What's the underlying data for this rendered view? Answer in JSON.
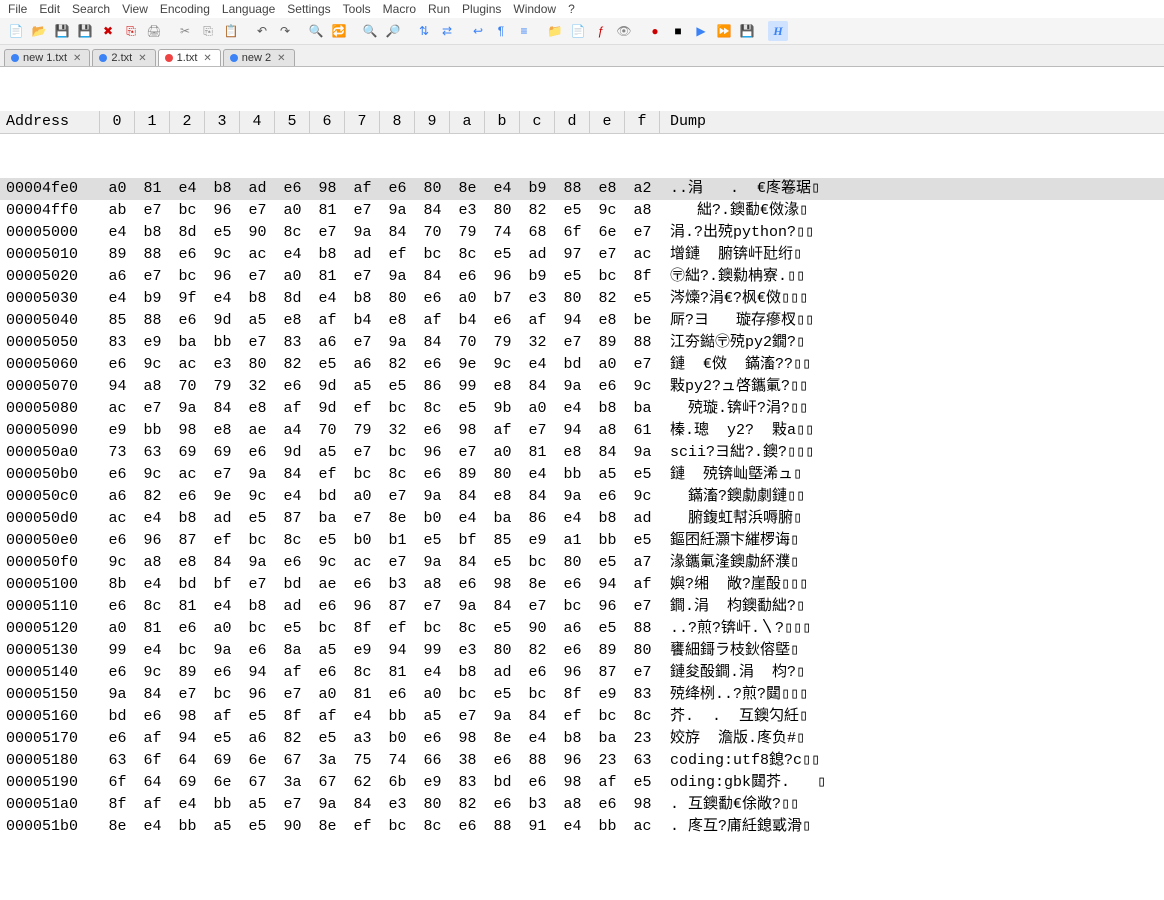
{
  "menu": [
    "File",
    "Edit",
    "Search",
    "View",
    "Encoding",
    "Language",
    "Settings",
    "Tools",
    "Macro",
    "Run",
    "Plugins",
    "Window",
    "?"
  ],
  "tabs": [
    {
      "label": "new 1.txt",
      "color": "#3b82f6",
      "active": false
    },
    {
      "label": "2.txt",
      "color": "#3b82f6",
      "active": false
    },
    {
      "label": "1.txt",
      "color": "#ef4444",
      "active": true
    },
    {
      "label": "new 2",
      "color": "#3b82f6",
      "active": false
    }
  ],
  "toolbar_icons": [
    {
      "name": "new-file-icon",
      "glyph": "📄",
      "col": "#6aa84f"
    },
    {
      "name": "open-icon",
      "glyph": "📂",
      "col": "#e2b007"
    },
    {
      "name": "save-icon",
      "glyph": "💾",
      "col": "#4a86e8"
    },
    {
      "name": "save-all-icon",
      "glyph": "💾",
      "col": "#4a86e8"
    },
    {
      "name": "close-icon",
      "glyph": "✖",
      "col": "#c00"
    },
    {
      "name": "close-all-icon",
      "glyph": "⎘",
      "col": "#c00"
    },
    {
      "name": "print-icon",
      "glyph": "🖨",
      "col": "#888"
    },
    {
      "name": "sep"
    },
    {
      "name": "cut-icon",
      "glyph": "✂",
      "col": "#888"
    },
    {
      "name": "copy-icon",
      "glyph": "⎘",
      "col": "#888"
    },
    {
      "name": "paste-icon",
      "glyph": "📋",
      "col": "#888"
    },
    {
      "name": "sep"
    },
    {
      "name": "undo-icon",
      "glyph": "↶",
      "col": "#555"
    },
    {
      "name": "redo-icon",
      "glyph": "↷",
      "col": "#555"
    },
    {
      "name": "sep"
    },
    {
      "name": "find-icon",
      "glyph": "🔍",
      "col": "#555"
    },
    {
      "name": "replace-icon",
      "glyph": "🔁",
      "col": "#555"
    },
    {
      "name": "sep"
    },
    {
      "name": "zoom-in-icon",
      "glyph": "🔍",
      "col": "#3b82f6"
    },
    {
      "name": "zoom-out-icon",
      "glyph": "🔎",
      "col": "#3b82f6"
    },
    {
      "name": "sep"
    },
    {
      "name": "sync-v-icon",
      "glyph": "⇅",
      "col": "#3b82f6"
    },
    {
      "name": "sync-h-icon",
      "glyph": "⇄",
      "col": "#3b82f6"
    },
    {
      "name": "sep"
    },
    {
      "name": "wordwrap-icon",
      "glyph": "↩",
      "col": "#3b82f6"
    },
    {
      "name": "show-all-icon",
      "glyph": "¶",
      "col": "#3b82f6"
    },
    {
      "name": "indent-icon",
      "glyph": "≡",
      "col": "#3b82f6"
    },
    {
      "name": "sep"
    },
    {
      "name": "folder-icon",
      "glyph": "📁",
      "col": "#e2b007"
    },
    {
      "name": "doc-icon",
      "glyph": "📄",
      "col": "#e2b007"
    },
    {
      "name": "func-icon",
      "glyph": "ƒ",
      "col": "#c00"
    },
    {
      "name": "eye-icon",
      "glyph": "👁",
      "col": "#888"
    },
    {
      "name": "sep"
    },
    {
      "name": "record-icon",
      "glyph": "●",
      "col": "#c00"
    },
    {
      "name": "stop-icon",
      "glyph": "■",
      "col": "#000"
    },
    {
      "name": "play-icon",
      "glyph": "▶",
      "col": "#3b82f6"
    },
    {
      "name": "fast-icon",
      "glyph": "⏩",
      "col": "#3b82f6"
    },
    {
      "name": "save-macro-icon",
      "glyph": "💾",
      "col": "#4a86e8"
    },
    {
      "name": "sep"
    },
    {
      "name": "hex-icon",
      "glyph": "H",
      "col": "#3b82f6"
    }
  ],
  "hex_header": {
    "address": "Address",
    "cols": [
      "0",
      "1",
      "2",
      "3",
      "4",
      "5",
      "6",
      "7",
      "8",
      "9",
      "a",
      "b",
      "c",
      "d",
      "e",
      "f"
    ],
    "dump": "Dump"
  },
  "hex_rows": [
    {
      "a": "00004fe0",
      "b": [
        "a0",
        "81",
        "e4",
        "b8",
        "ad",
        "e6",
        "98",
        "af",
        "e6",
        "80",
        "8e",
        "e4",
        "b9",
        "88",
        "e8",
        "a2"
      ],
      "d": "..涓   .  €庝箞琚▯"
    },
    {
      "a": "00004ff0",
      "b": [
        "ab",
        "e7",
        "bc",
        "96",
        "e7",
        "a0",
        "81",
        "e7",
        "9a",
        "84",
        "e3",
        "80",
        "82",
        "e5",
        "9c",
        "a8"
      ],
      "d": "   絀?.鐭勫€傚湪▯"
    },
    {
      "a": "00005000",
      "b": [
        "e4",
        "b8",
        "8d",
        "e5",
        "90",
        "8c",
        "e7",
        "9a",
        "84",
        "70",
        "79",
        "74",
        "68",
        "6f",
        "6e",
        "e7"
      ],
      "d": "涓.?出殑python?▯▯"
    },
    {
      "a": "00005010",
      "b": [
        "89",
        "88",
        "e6",
        "9c",
        "ac",
        "e4",
        "b8",
        "ad",
        "ef",
        "bc",
        "8c",
        "e5",
        "ad",
        "97",
        "e7",
        "ac"
      ],
      "d": "增鏈  腑锛屽瓧绗▯"
    },
    {
      "a": "00005020",
      "b": [
        "a6",
        "e7",
        "bc",
        "96",
        "e7",
        "a0",
        "81",
        "e7",
        "9a",
        "84",
        "e6",
        "96",
        "b9",
        "e5",
        "bc",
        "8f"
      ],
      "d": "〶絀?.鐭勬柟寮.▯▯"
    },
    {
      "a": "00005030",
      "b": [
        "e4",
        "b9",
        "9f",
        "e4",
        "b8",
        "8d",
        "e4",
        "b8",
        "80",
        "e6",
        "a0",
        "b7",
        "e3",
        "80",
        "82",
        "e5"
      ],
      "d": "涔燺?涓€?枫€傚▯▯▯"
    },
    {
      "a": "00005040",
      "b": [
        "85",
        "88",
        "e6",
        "9d",
        "a5",
        "e8",
        "af",
        "b4",
        "e8",
        "af",
        "b4",
        "e6",
        "af",
        "94",
        "e8",
        "be"
      ],
      "d": "厛?ヨ   璇存瘮杈▯▯"
    },
    {
      "a": "00005050",
      "b": [
        "83",
        "e9",
        "ba",
        "bb",
        "e7",
        "83",
        "a6",
        "e7",
        "9a",
        "84",
        "70",
        "79",
        "32",
        "e7",
        "89",
        "88"
      ],
      "d": "江夯鐑〶殑py2鐗?▯"
    },
    {
      "a": "00005060",
      "b": [
        "e6",
        "9c",
        "ac",
        "e3",
        "80",
        "82",
        "e5",
        "a6",
        "82",
        "e6",
        "9e",
        "9c",
        "e4",
        "bd",
        "a0",
        "e7"
      ],
      "d": "鏈  €傚  鏋滀??▯▯"
    },
    {
      "a": "00005070",
      "b": [
        "94",
        "a8",
        "70",
        "79",
        "32",
        "e6",
        "9d",
        "a5",
        "e5",
        "86",
        "99",
        "e8",
        "84",
        "9a",
        "e6",
        "9c"
      ],
      "d": "敤py2?ュ啓鑴氭?▯▯"
    },
    {
      "a": "00005080",
      "b": [
        "ac",
        "e7",
        "9a",
        "84",
        "e8",
        "af",
        "9d",
        "ef",
        "bc",
        "8c",
        "e5",
        "9b",
        "a0",
        "e4",
        "b8",
        "ba"
      ],
      "d": "  殑璇.锛屽?涓?▯▯"
    },
    {
      "a": "00005090",
      "b": [
        "e9",
        "bb",
        "98",
        "e8",
        "ae",
        "a4",
        "70",
        "79",
        "32",
        "e6",
        "98",
        "af",
        "e7",
        "94",
        "a8",
        "61"
      ],
      "d": "榛.璁  y2?  敤a▯▯"
    },
    {
      "a": "000050a0",
      "b": [
        "73",
        "63",
        "69",
        "69",
        "e6",
        "9d",
        "a5",
        "e7",
        "bc",
        "96",
        "e7",
        "a0",
        "81",
        "e8",
        "84",
        "9a"
      ],
      "d": "scii?ヨ絀?.鐭?▯▯▯"
    },
    {
      "a": "000050b0",
      "b": [
        "e6",
        "9c",
        "ac",
        "e7",
        "9a",
        "84",
        "ef",
        "bc",
        "8c",
        "e6",
        "89",
        "80",
        "e4",
        "bb",
        "a5",
        "e5"
      ],
      "d": "鏈  殑锛屾墍浠ュ▯"
    },
    {
      "a": "000050c0",
      "b": [
        "a6",
        "82",
        "e6",
        "9e",
        "9c",
        "e4",
        "bd",
        "a0",
        "e7",
        "9a",
        "84",
        "e8",
        "84",
        "9a",
        "e6",
        "9c"
      ],
      "d": "  鏋滀?鐭勮劇鏈▯▯"
    },
    {
      "a": "000050d0",
      "b": [
        "ac",
        "e4",
        "b8",
        "ad",
        "e5",
        "87",
        "ba",
        "e7",
        "8e",
        "b0",
        "e4",
        "ba",
        "86",
        "e4",
        "b8",
        "ad"
      ],
      "d": "  腑鍑虹幇浜嗕腑▯"
    },
    {
      "a": "000050e0",
      "b": [
        "e6",
        "96",
        "87",
        "ef",
        "bc",
        "8c",
        "e5",
        "b0",
        "b1",
        "e5",
        "bf",
        "85",
        "e9",
        "a1",
        "bb",
        "e5"
      ],
      "d": "鏂囨紝灝卞繀椤诲▯"
    },
    {
      "a": "000050f0",
      "b": [
        "9c",
        "a8",
        "e8",
        "84",
        "9a",
        "e6",
        "9c",
        "ac",
        "e7",
        "9a",
        "84",
        "e5",
        "bc",
        "80",
        "e5",
        "a7"
      ],
      "d": "湪鑴氭湰鐭勮紑濮▯"
    },
    {
      "a": "00005100",
      "b": [
        "8b",
        "e4",
        "bd",
        "bf",
        "e7",
        "bd",
        "ae",
        "e6",
        "b3",
        "a8",
        "e6",
        "98",
        "8e",
        "e6",
        "94",
        "af"
      ],
      "d": "嬩?缃  敞?崖酘▯▯▯"
    },
    {
      "a": "00005110",
      "b": [
        "e6",
        "8c",
        "81",
        "e4",
        "b8",
        "ad",
        "e6",
        "96",
        "87",
        "e7",
        "9a",
        "84",
        "e7",
        "bc",
        "96",
        "e7"
      ],
      "d": "鐧.涓  枃鐭勫絀?▯"
    },
    {
      "a": "00005120",
      "b": [
        "a0",
        "81",
        "e6",
        "a0",
        "bc",
        "e5",
        "bc",
        "8f",
        "ef",
        "bc",
        "8c",
        "e5",
        "90",
        "a6",
        "e5",
        "88"
      ],
      "d": "..?煎?锛屽.〵?▯▯▯"
    },
    {
      "a": "00005130",
      "b": [
        "99",
        "e4",
        "bc",
        "9a",
        "e6",
        "8a",
        "a5",
        "e9",
        "94",
        "99",
        "e3",
        "80",
        "82",
        "e6",
        "89",
        "80"
      ],
      "d": "饔細鎶ラ枝鈥傛墍▯"
    },
    {
      "a": "00005140",
      "b": [
        "e6",
        "9c",
        "89",
        "e6",
        "94",
        "af",
        "e6",
        "8c",
        "81",
        "e4",
        "b8",
        "ad",
        "e6",
        "96",
        "87",
        "e7"
      ],
      "d": "鏈夋酘鐧.涓  枃?▯"
    },
    {
      "a": "00005150",
      "b": [
        "9a",
        "84",
        "e7",
        "bc",
        "96",
        "e7",
        "a0",
        "81",
        "e6",
        "a0",
        "bc",
        "e5",
        "bc",
        "8f",
        "e9",
        "83"
      ],
      "d": "殑绛栵..?煎?閮▯▯▯"
    },
    {
      "a": "00005160",
      "b": [
        "bd",
        "e6",
        "98",
        "af",
        "e5",
        "8f",
        "af",
        "e4",
        "bb",
        "a5",
        "e7",
        "9a",
        "84",
        "ef",
        "bc",
        "8c"
      ],
      "d": "芥.  .  互鐭勽紝▯"
    },
    {
      "a": "00005170",
      "b": [
        "e6",
        "af",
        "94",
        "e5",
        "a6",
        "82",
        "e5",
        "a3",
        "b0",
        "e6",
        "98",
        "8e",
        "e4",
        "b8",
        "ba",
        "23"
      ],
      "d": "姣斿  澹版.庝负#▯"
    },
    {
      "a": "00005180",
      "b": [
        "63",
        "6f",
        "64",
        "69",
        "6e",
        "67",
        "3a",
        "75",
        "74",
        "66",
        "38",
        "e6",
        "88",
        "96",
        "23",
        "63"
      ],
      "d": "coding:utf8鎴?c▯▯"
    },
    {
      "a": "00005190",
      "b": [
        "6f",
        "64",
        "69",
        "6e",
        "67",
        "3a",
        "67",
        "62",
        "6b",
        "e9",
        "83",
        "bd",
        "e6",
        "98",
        "af",
        "e5"
      ],
      "d": "oding:gbk閮芥.   ▯"
    },
    {
      "a": "000051a0",
      "b": [
        "8f",
        "af",
        "e4",
        "bb",
        "a5",
        "e7",
        "9a",
        "84",
        "e3",
        "80",
        "82",
        "e6",
        "b3",
        "a8",
        "e6",
        "98"
      ],
      "d": ". 互鐭勫€俆敞?▯▯"
    },
    {
      "a": "000051b0",
      "b": [
        "8e",
        "e4",
        "bb",
        "a5",
        "e5",
        "90",
        "8e",
        "ef",
        "bc",
        "8c",
        "e6",
        "88",
        "91",
        "e4",
        "bb",
        "ac"
      ],
      "d": ". 庝互?庯紝鎴戜滑▯"
    }
  ]
}
